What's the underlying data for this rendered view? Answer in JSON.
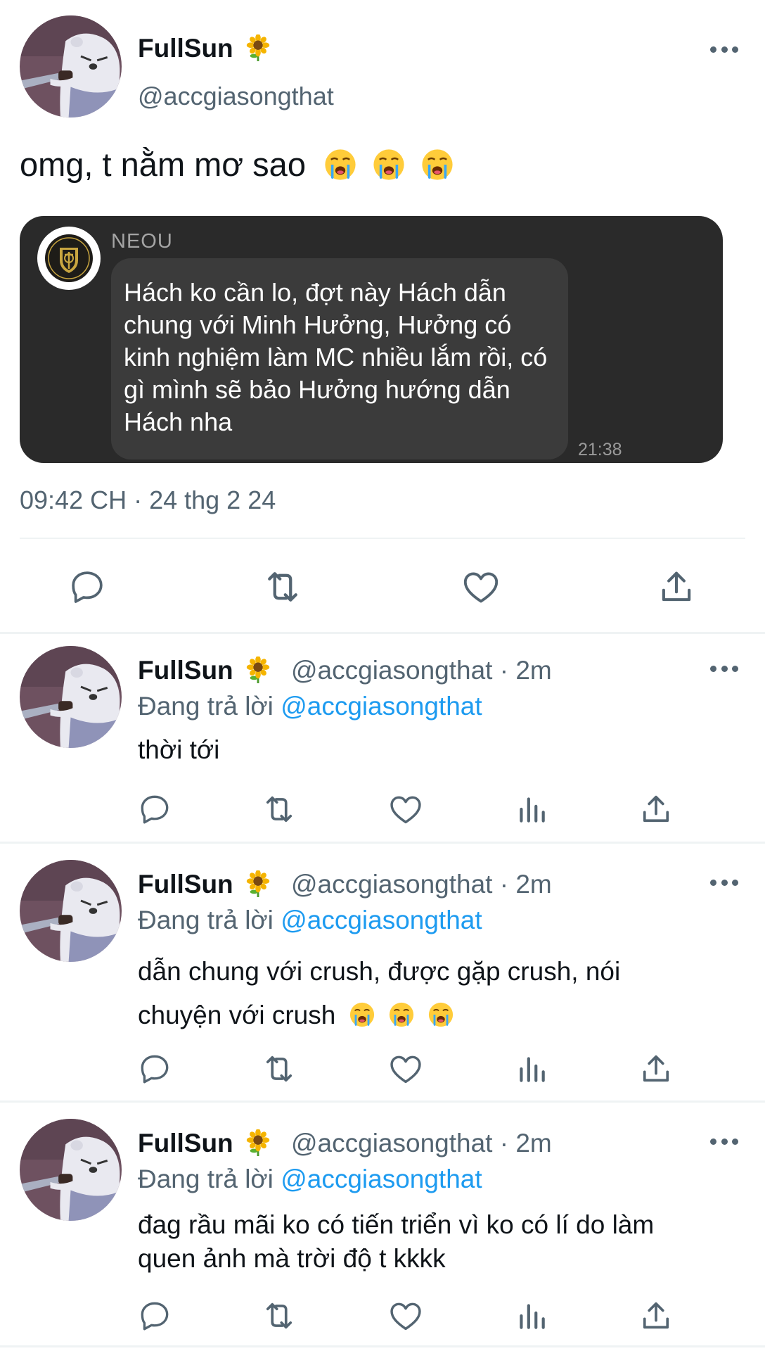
{
  "main_tweet": {
    "display_name": "FullSun",
    "name_emoji": "sunflower",
    "handle": "@accgiasongthat",
    "text": "omg, t nằm mơ sao",
    "text_emoji": [
      "loudly-crying-face",
      "loudly-crying-face",
      "loudly-crying-face"
    ],
    "quoted_image": {
      "sender": "NEOU",
      "message": "Hách ko cần lo, đợt này Hách dẫn chung với Minh Hưởng, Hưởng có kinh nghiệm làm MC nhiều lắm rồi, có gì mình sẽ bảo Hưởng hướng dẫn Hách nha",
      "time": "21:38"
    },
    "timestamp": "09:42 CH · 24 thg 2 24",
    "actions": [
      "reply-icon",
      "retweet-icon",
      "like-icon",
      "share-icon"
    ]
  },
  "replies": [
    {
      "display_name": "FullSun",
      "handle_time": "@accgiasongthat · 2m",
      "replying_prefix": "Đang trả lời",
      "replying_mention": "@accgiasongthat",
      "text": "thời tới",
      "has_emoji": false
    },
    {
      "display_name": "FullSun",
      "handle_time": "@accgiasongthat · 2m",
      "replying_prefix": "Đang trả lời",
      "replying_mention": "@accgiasongthat",
      "text_line1": "dẫn chung với crush, được gặp crush, nói",
      "text_line2": "chuyện với crush",
      "has_emoji": true
    },
    {
      "display_name": "FullSun",
      "handle_time": "@accgiasongthat · 2m",
      "replying_prefix": "Đang trả lời",
      "replying_mention": "@accgiasongthat",
      "text_line1": "đag rầu mãi ko có tiến triển vì ko có lí do làm",
      "text_line2": "quen ảnh mà trời độ t kkkk",
      "has_emoji": false
    }
  ],
  "colors": {
    "text": "#0f1419",
    "secondary": "#536471",
    "link": "#1d9bf0",
    "divider": "#eff3f4",
    "chat_bg": "#2a2a2a",
    "chat_bubble": "#3b3b3b"
  }
}
